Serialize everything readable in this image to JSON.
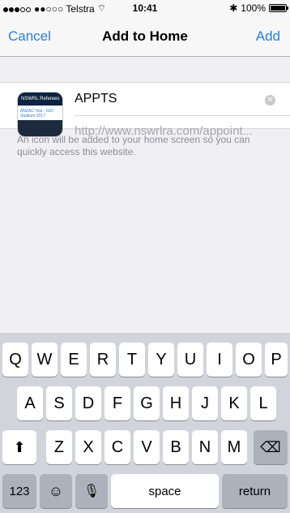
{
  "status": {
    "carrier": "●●○○○ Telstra",
    "time": "10:41",
    "battery": "100%",
    "bt": "✱"
  },
  "nav": {
    "cancel": "Cancel",
    "title": "Add to Home",
    "add": "Add"
  },
  "card": {
    "thumb_banner": "NSWRL Referees",
    "thumb_text": "ANZAC Test - GIO Stadium 2017",
    "name": "APPTS",
    "url": "http://www.nswrlra.com/appoint..."
  },
  "note": "An icon will be added to your home screen so you can quickly access this website.",
  "keyboard": {
    "row1": [
      "Q",
      "W",
      "E",
      "R",
      "T",
      "Y",
      "U",
      "I",
      "O",
      "P"
    ],
    "row2": [
      "A",
      "S",
      "D",
      "F",
      "G",
      "H",
      "J",
      "K",
      "L"
    ],
    "row3": [
      "Z",
      "X",
      "C",
      "V",
      "B",
      "N",
      "M"
    ],
    "num": "123",
    "space": "space",
    "return": "return"
  },
  "icons": {
    "wifi": "wifi-icon",
    "bluetooth": "bluetooth-icon",
    "shift": "shift-icon",
    "delete": "delete-icon",
    "emoji": "emoji-icon",
    "mic": "mic-icon",
    "clear": "clear-icon"
  }
}
